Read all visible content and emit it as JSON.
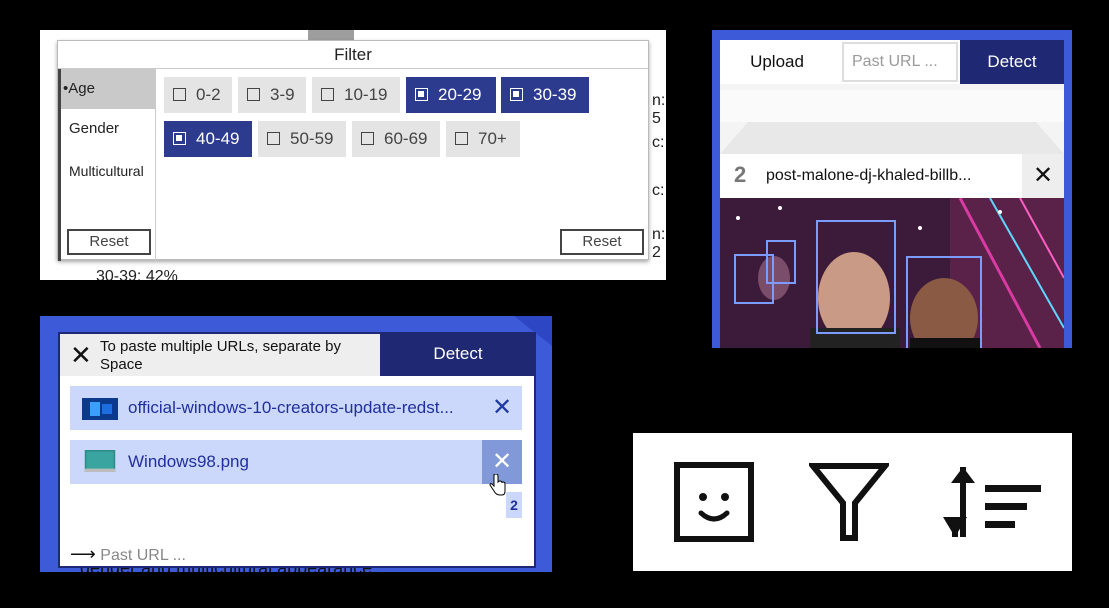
{
  "filter_panel": {
    "title": "Filter",
    "side_items": [
      "Age",
      "Gender",
      "Multicultural"
    ],
    "reset_left": "Reset",
    "reset_right": "Reset",
    "age_options": [
      {
        "label": "0-2",
        "checked": false
      },
      {
        "label": "3-9",
        "checked": false
      },
      {
        "label": "10-19",
        "checked": false
      },
      {
        "label": "20-29",
        "checked": true
      },
      {
        "label": "30-39",
        "checked": true
      },
      {
        "label": "40-49",
        "checked": true
      },
      {
        "label": "50-59",
        "checked": false
      },
      {
        "label": "60-69",
        "checked": false
      },
      {
        "label": "70+",
        "checked": false
      }
    ],
    "background_text": {
      "line_bottom": "30-39: 42%",
      "r1": "n: 5",
      "r2": "c:",
      "r3": "c:",
      "r4": "n: 2"
    }
  },
  "upload_panel": {
    "upload_label": "Upload",
    "url_placeholder": "Past URL ...",
    "detect_label": "Detect",
    "file_number": "2",
    "file_name": "post-malone-dj-khaled-billb...",
    "close_glyph": "✕"
  },
  "paste_panel": {
    "close_glyph": "✕",
    "hint": "To paste multiple URLs, separate by Space",
    "detect_label": "Detect",
    "files": [
      {
        "name": "official-windows-10-creators-update-redst...",
        "icon": "windows10-thumbnail"
      },
      {
        "name": "Windows98.png",
        "icon": "windows98-thumbnail"
      }
    ],
    "remove_glyph": "✕",
    "count_badge": "2",
    "arrow": "⟶",
    "paste_placeholder": "Past URL ...",
    "background_text": "gender and multicultural appearance"
  },
  "icons_panel": {
    "icons": [
      "face-icon",
      "filter-icon",
      "sort-icon"
    ]
  },
  "colors": {
    "accent_blue": "#3d5bd9",
    "dark_navy": "#1f2872",
    "selected_chip": "#2d3b8f",
    "light_blue_row": "#ccd8fb"
  }
}
